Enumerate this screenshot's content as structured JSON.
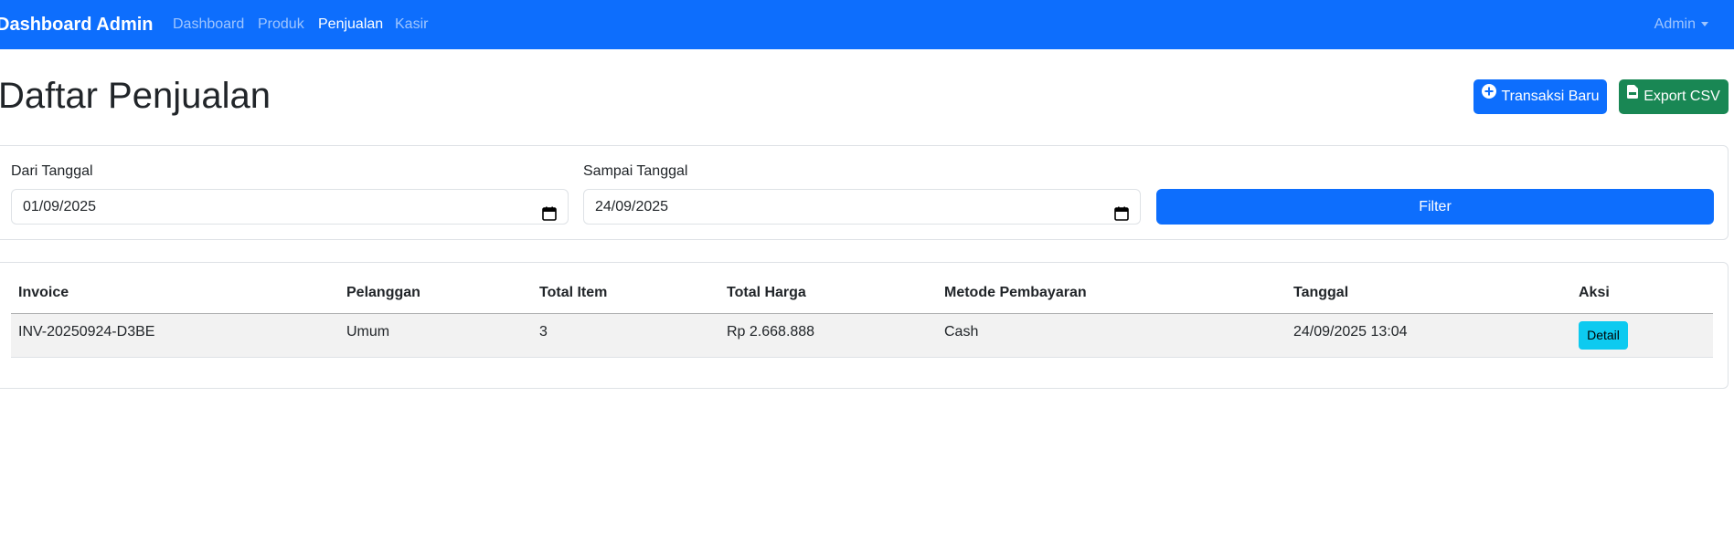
{
  "navbar": {
    "brand": "Dashboard Admin",
    "links": [
      {
        "label": "Dashboard",
        "active": false
      },
      {
        "label": "Produk",
        "active": false
      },
      {
        "label": "Penjualan",
        "active": true
      },
      {
        "label": "Kasir",
        "active": false
      }
    ],
    "user_menu": "Admin"
  },
  "page": {
    "title": "Daftar Penjualan",
    "new_transaction_label": "Transaksi Baru",
    "export_label": "Export CSV"
  },
  "filter": {
    "from_label": "Dari Tanggal",
    "from_value": "01/09/2025",
    "to_label": "Sampai Tanggal",
    "to_value": "24/09/2025",
    "button_label": "Filter"
  },
  "table": {
    "columns": [
      "Invoice",
      "Pelanggan",
      "Total Item",
      "Total Harga",
      "Metode Pembayaran",
      "Tanggal",
      "Aksi"
    ],
    "rows": [
      {
        "invoice": "INV-20250924-D3BE",
        "customer": "Umum",
        "total_item": "3",
        "total_price": "Rp 2.668.888",
        "payment_method": "Cash",
        "date": "24/09/2025 13:04",
        "action_label": "Detail"
      }
    ]
  },
  "colors": {
    "primary": "#0d6efd",
    "success": "#198754",
    "info": "#0dcaf0"
  },
  "icons": {
    "new_transaction": "plus-circle-icon",
    "export": "csv-file-icon",
    "date_picker": "calendar-icon",
    "user_menu": "caret-down-icon"
  }
}
